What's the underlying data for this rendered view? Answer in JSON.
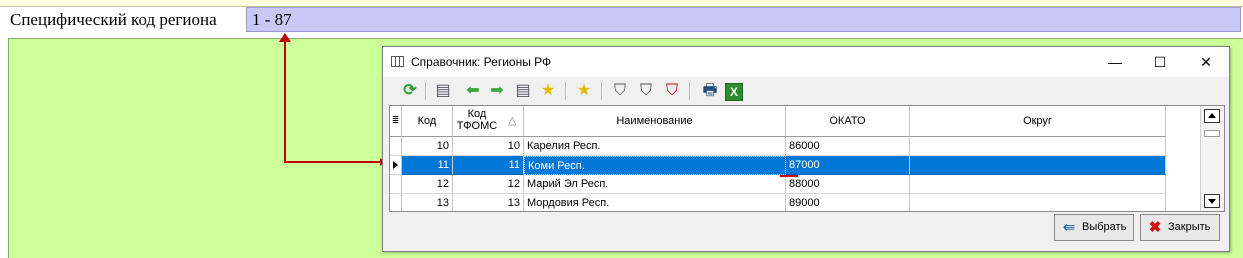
{
  "field": {
    "label": "Специфический код региона",
    "value": "1 - 87"
  },
  "dialog": {
    "title": "Справочник: Регионы РФ",
    "window_buttons": {
      "minimize": "—",
      "maximize": "☐",
      "close": "✕"
    },
    "toolbar": {
      "refresh": "⟳",
      "columns": "▤",
      "back": "⬅",
      "forward": "➡",
      "columns2": "▤",
      "add_star": "★",
      "pin_star": "★",
      "filter": "⛉",
      "filter_edit": "⛉",
      "filter_clear": "⛉",
      "print": "🖶",
      "excel": "X"
    },
    "grid": {
      "columns": [
        "Код",
        "Код ТФОМС",
        "Наименование",
        "ОКАТО",
        "Округ"
      ],
      "sort_marker": "△",
      "rows": [
        {
          "kod": "10",
          "tfoms": "10",
          "name": "Карелия Респ.",
          "okato": "86000",
          "okrug": ""
        },
        {
          "kod": "11",
          "tfoms": "11",
          "name": "Коми Респ.",
          "okato": "87000",
          "okrug": ""
        },
        {
          "kod": "12",
          "tfoms": "12",
          "name": "Марий Эл Респ.",
          "okato": "88000",
          "okrug": ""
        },
        {
          "kod": "13",
          "tfoms": "13",
          "name": "Мордовия Респ.",
          "okato": "89000",
          "okrug": ""
        }
      ],
      "selected_row": 1
    },
    "buttons": {
      "select": "Выбрать",
      "close": "Закрыть"
    }
  },
  "colors": {
    "field_bg": "#c9c9f5",
    "form_bg": "#ccff99",
    "selection": "#0078d7",
    "arrow": "#c00000"
  }
}
